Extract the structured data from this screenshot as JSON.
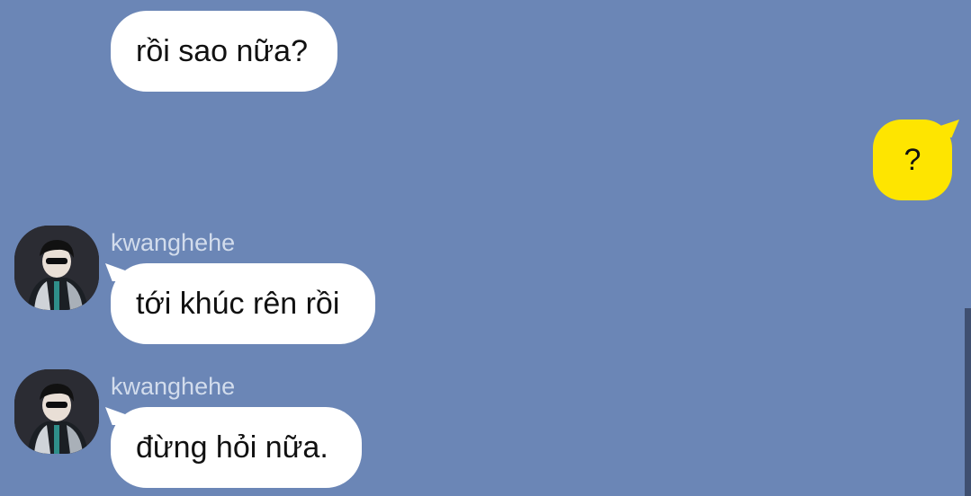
{
  "messages": [
    {
      "direction": "incoming",
      "sender": "",
      "text": "rồi sao nữa?"
    },
    {
      "direction": "outgoing",
      "text": "?"
    },
    {
      "direction": "incoming",
      "sender": "kwanghehe",
      "text": "tới khúc rên rồi"
    },
    {
      "direction": "incoming",
      "sender": "kwanghehe",
      "text": "đừng hỏi nữa."
    }
  ],
  "colors": {
    "background": "#6b86b6",
    "incoming_bubble": "#ffffff",
    "outgoing_bubble": "#fee500",
    "sender_name": "#d2dcec"
  }
}
